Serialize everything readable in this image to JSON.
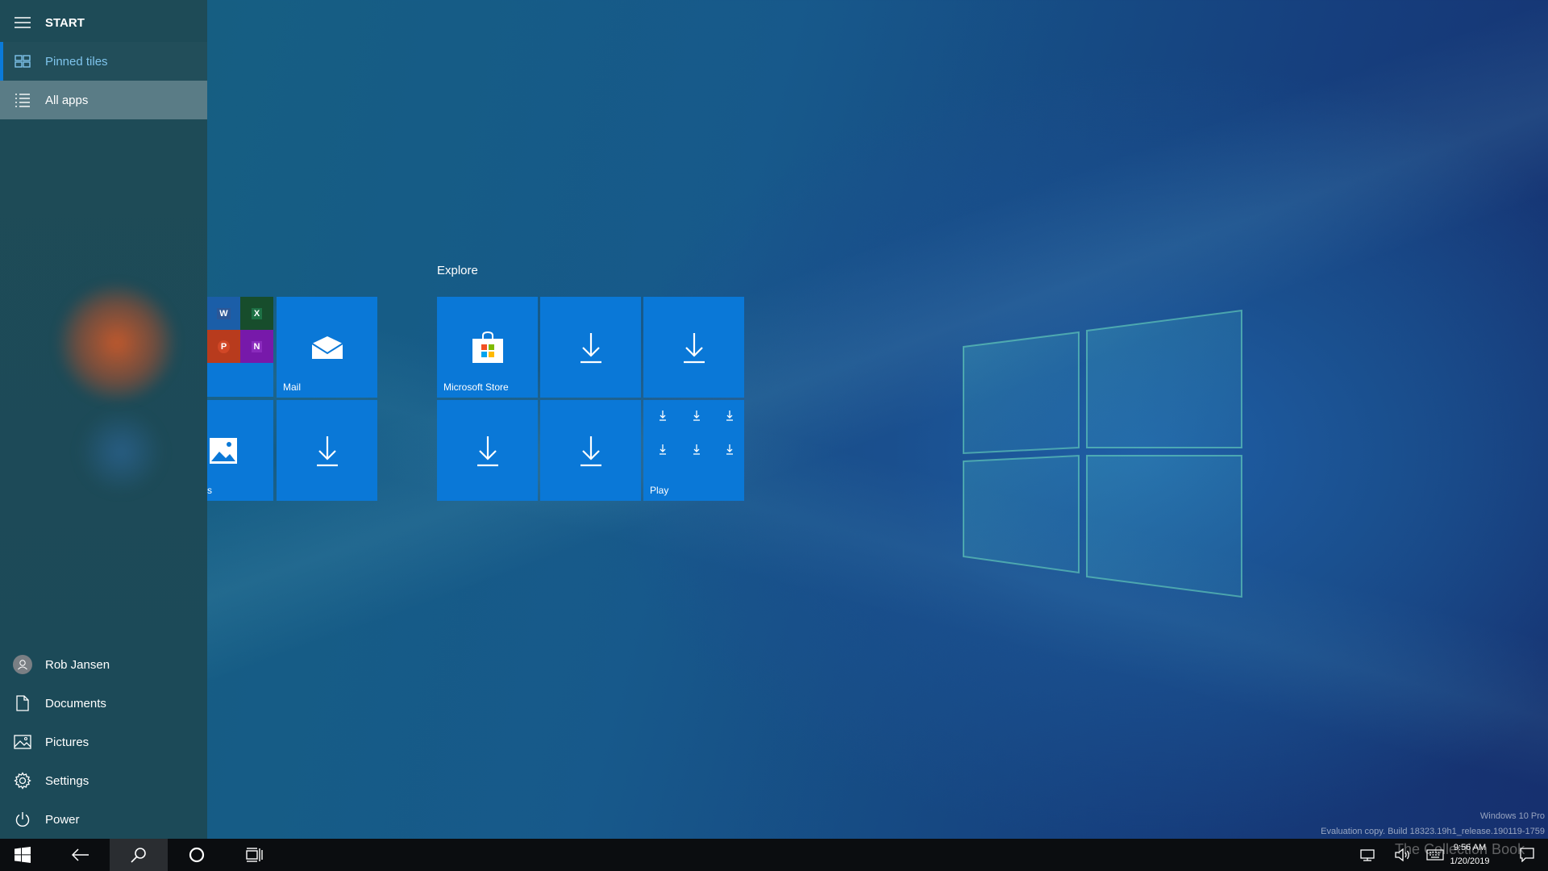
{
  "start": {
    "title": "START",
    "nav": [
      {
        "label": "Pinned tiles",
        "icon": "pinned-tiles-icon"
      },
      {
        "label": "All apps",
        "icon": "all-apps-list-icon"
      }
    ],
    "bottom": [
      {
        "label": "Rob Jansen",
        "icon": "user-avatar-icon"
      },
      {
        "label": "Documents",
        "icon": "document-icon"
      },
      {
        "label": "Pictures",
        "icon": "pictures-icon"
      },
      {
        "label": "Settings",
        "icon": "gear-icon"
      },
      {
        "label": "Power",
        "icon": "power-icon"
      }
    ]
  },
  "tiles": {
    "office_small": [
      "W",
      "X",
      "P",
      "N"
    ],
    "mail": "Mail",
    "photos_partial": "s",
    "group_explore": "Explore",
    "store": "Microsoft Store",
    "play": "Play"
  },
  "taskbar": {
    "icons": [
      "windows-start-icon",
      "back-arrow-icon",
      "search-icon",
      "cortana-circle-icon",
      "task-view-icon"
    ],
    "time": "9:56 AM",
    "date": "1/20/2019"
  },
  "watermark": {
    "edition": "Windows 10 Pro",
    "build": "Evaluation copy. Build 18323.19h1_release.190119-1759",
    "brand": "The Collection Book"
  },
  "colors": {
    "tile_blue": "#0a78d7",
    "accent": "#0a7ad9",
    "pinned_text": "#7fc4ec"
  }
}
